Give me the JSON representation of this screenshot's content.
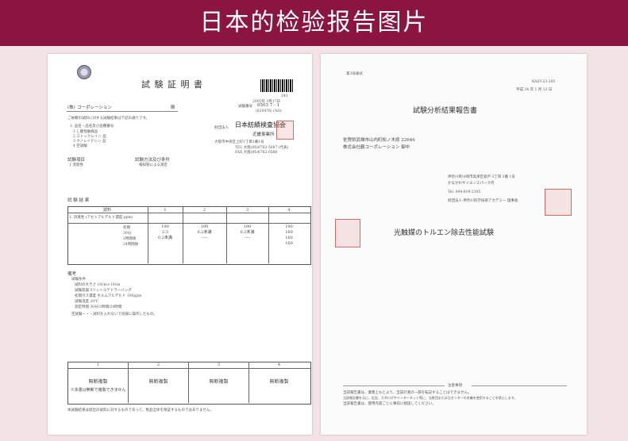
{
  "banner": {
    "title": "日本的检验报告图片"
  },
  "left_doc": {
    "title": "試 験 証 明 書",
    "no_top": "241",
    "date_no": "2005年 3月17日",
    "doc_no_label": "試験番号",
    "doc_no": "6503 7 - 1",
    "sub_no": "(820476)  (%0)",
    "recipient": "(株)",
    "recipient_suffix": "コーポレーション",
    "honorific": "殿",
    "intro": "ご依頼の試料に対する試験結果は下記の通りです。",
    "items": [
      "1. 品名・品名及び品種番号",
      "1  し酸性触媒品",
      "2  ストックレイン 品",
      "3  クノレイト゚シン 品",
      "4  空試験"
    ],
    "org_label": "財団法人",
    "org_name": "日本紡績検査協会",
    "org_sub": "近畿事業所",
    "org_addr": "大阪市中央区上町1丁目1番1号",
    "org_tel1": "TEL 大阪(06)6762-5687 (代表)",
    "org_tel2": "FAX 大阪(06)6762-0588",
    "test_item_label": "試験項目",
    "test_method_label": "試験方法及び条件",
    "test_item": "1 消臭性",
    "test_method": "検知管による測定",
    "result_label": "試 験 結 果",
    "table_headers": [
      "試料",
      "1",
      "2",
      "3",
      "4"
    ],
    "row_label": "1. 消臭性 (アセトアルデヒド濃度 ppm)",
    "rows": [
      {
        "time": "初期",
        "v": [
          "190",
          "190",
          "190",
          "190"
        ]
      },
      {
        "time": "30分",
        "v": [
          "2.3",
          "0.2未満",
          "0.2未満",
          "160"
        ]
      },
      {
        "time": "2時間後",
        "v": [
          "0.2未満",
          "-----",
          "-----",
          "160"
        ]
      },
      {
        "time": "24時間後",
        "v": [
          "",
          "",
          "",
          "160"
        ]
      }
    ],
    "remarks_label": "備考",
    "remarks": [
      "試験条件",
      "試料の大きさ 10cm×10cm",
      "試験容器 5リットルテドラーバッグ",
      "初期ガス濃度 ホルムアルデヒド 100ppm",
      "試験温度 20℃",
      "測定時間 30分/2時間/24時間",
      "空試験・・・試料を入れないで同様に操作したもの。"
    ],
    "seal_boxes": [
      "無断複製",
      "無断複製",
      "無断複製",
      "無断複製"
    ],
    "seal_box_label": "※本書は無断で複製できません",
    "seal_numbers": [
      "1",
      "2",
      "3",
      "4"
    ],
    "footer": "本試験結果は提出の試料に対するものであって、製品全体を保証するものではありません。"
  },
  "right_doc": {
    "form_no": "第3号様式",
    "ref_no": "KAST-23-205",
    "date": "平成 24 年 1 月 12 日",
    "title": "試験分析結果報告書",
    "addr": "佐賀県武雄市山内町松ノ木原 22646",
    "company": "株式会社鶴コーポレーション  御中",
    "inst_addr": "神奈川県川崎市高津区坂戸 3丁目 2番 1号",
    "inst_name": "かながわサイエンスパーク内",
    "inst_tel": "Tel. 044-819-2105",
    "inst_org": "財団法人  神奈川科学技術アカデミー 理事長",
    "subject": "光触媒のトルエン除去性能試験",
    "notice_title": "注意事項",
    "notice_lines": [
      "当該報告書は、業務上もとより、当該計測の一部を転記することはできません。",
      "当該報告書を元に、広告、カタログやインターネット等に、当財団または当センターの名義を使用することを禁止します。",
      "当該報告書は、使用内容ごとに事前に相談してください。"
    ]
  }
}
